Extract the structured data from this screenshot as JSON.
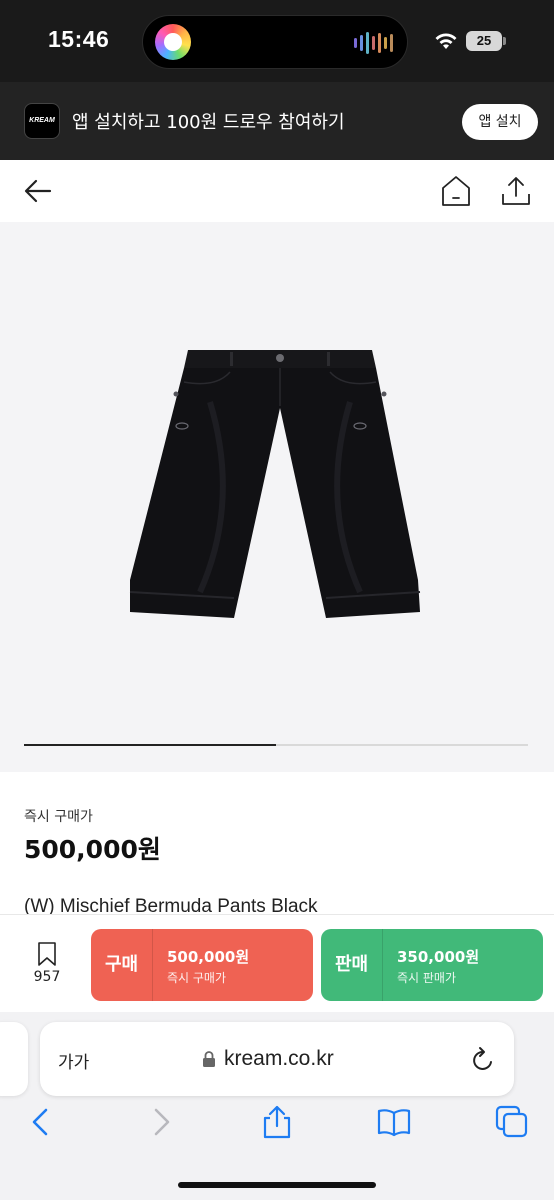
{
  "status_bar": {
    "time": "15:46",
    "battery": "25"
  },
  "app_banner": {
    "logo_text": "KREAM",
    "message": "앱 설치하고 100원 드로우 참여하기",
    "install_label": "앱 설치"
  },
  "icons": {
    "back": "arrow-left-icon",
    "home": "home-icon",
    "share": "share-icon",
    "bookmark": "bookmark-icon",
    "lock": "lock-icon",
    "reload": "reload-icon",
    "safari_back": "chevron-left-icon",
    "safari_forward": "chevron-right-icon",
    "safari_share": "share-icon",
    "safari_bookmarks": "book-icon",
    "safari_tabs": "tabs-icon"
  },
  "product": {
    "image_carousel": {
      "current": 1,
      "total": 2
    },
    "price_label": "즉시 구매가",
    "price": "500,000원",
    "name": "(W) Mischief Bermuda Pants Black"
  },
  "action_bar": {
    "wish_count": "957",
    "buy": {
      "label": "구매",
      "price": "500,000원",
      "sub": "즉시 구매가",
      "color": "#ef6253"
    },
    "sell": {
      "label": "판매",
      "price": "350,000원",
      "sub": "즉시 판매가",
      "color": "#41b979"
    }
  },
  "safari": {
    "text_size_label": "가가",
    "url": "kream.co.kr"
  }
}
